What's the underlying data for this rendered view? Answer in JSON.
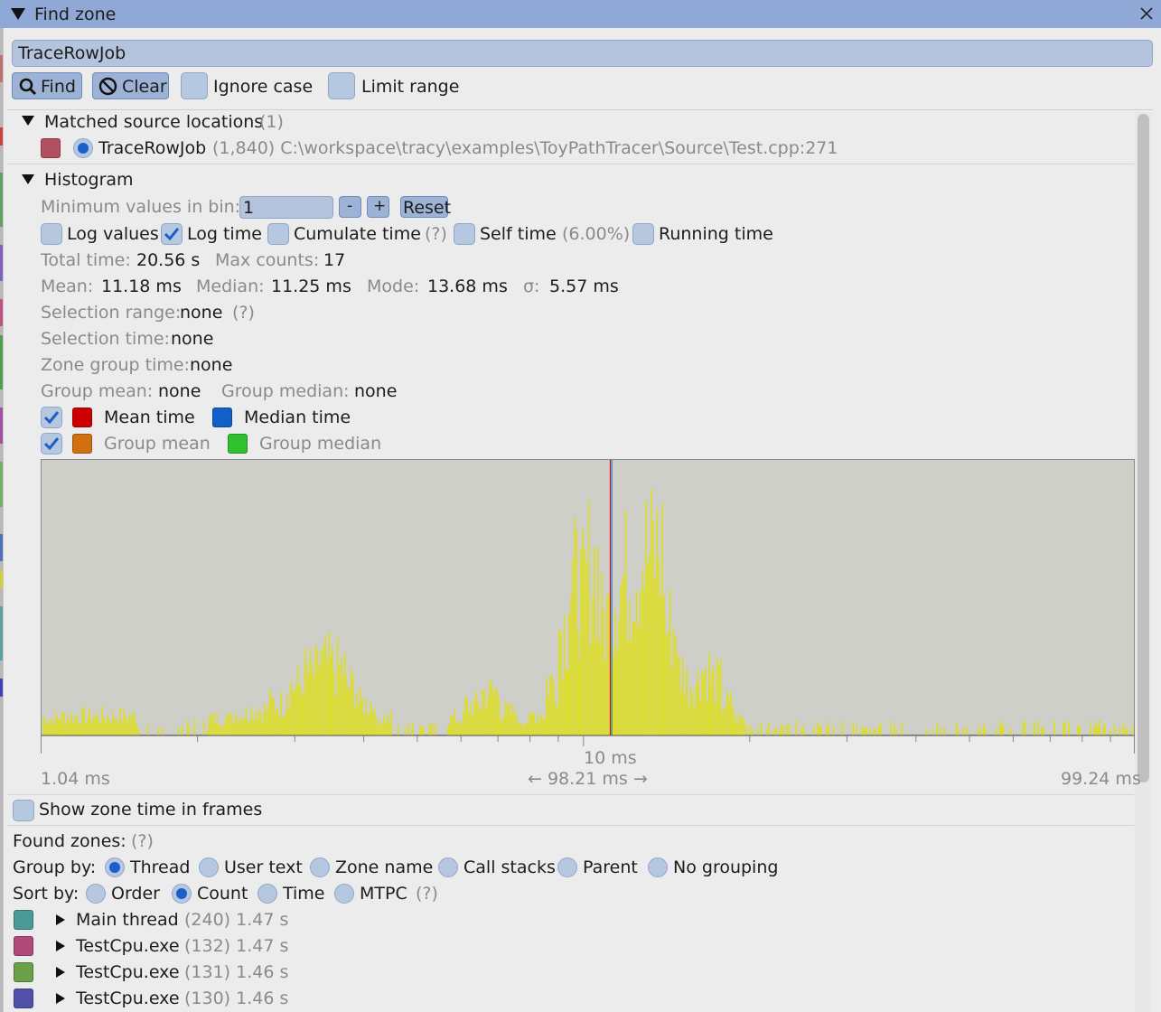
{
  "window": {
    "title": "Find zone",
    "close_icon": "close-icon"
  },
  "search": {
    "value": "TraceRowJob"
  },
  "toolbar": {
    "find_label": "Find",
    "find_icon": "search-icon",
    "clear_label": "Clear",
    "clear_icon": "ban-icon",
    "ignore_case_label": "Ignore case",
    "ignore_case_checked": false,
    "limit_range_label": "Limit range",
    "limit_range_checked": false
  },
  "matched": {
    "header": "Matched source locations",
    "count": "(1)",
    "item": {
      "name": "TraceRowJob",
      "info": "(1,840) C:\\workspace\\tracy\\examples\\ToyPathTracer\\Source\\Test.cpp:271",
      "color": "#b05060",
      "selected": true
    }
  },
  "histogram": {
    "header": "Histogram",
    "min_bin_label": "Minimum values in bin:",
    "min_bin_value": "1",
    "minus_label": "-",
    "plus_label": "+",
    "reset_label": "Reset",
    "options": {
      "log_values": {
        "label": "Log values",
        "checked": false
      },
      "log_time": {
        "label": "Log time",
        "checked": true
      },
      "cumulate_time": {
        "label": "Cumulate time",
        "checked": false,
        "hint": "(?)"
      },
      "self_time": {
        "label": "Self time",
        "checked": false,
        "extra": "(6.00%)"
      },
      "running_time": {
        "label": "Running time",
        "checked": false
      }
    },
    "stats": {
      "total_time_label": "Total time:",
      "total_time": "20.56 s",
      "max_counts_label": "Max counts:",
      "max_counts": "17",
      "mean_label": "Mean:",
      "mean": "11.18 ms",
      "median_label": "Median:",
      "median": "11.25 ms",
      "mode_label": "Mode:",
      "mode": "13.68 ms",
      "sigma_label": "σ:",
      "sigma": "5.57 ms",
      "sel_range_label": "Selection range:",
      "sel_range": "none",
      "sel_range_hint": "(?)",
      "sel_time_label": "Selection time:",
      "sel_time": "none",
      "zone_group_label": "Zone group time:",
      "zone_group": "none",
      "group_mean_label": "Group mean:",
      "group_mean": "none",
      "group_median_label": "Group median:",
      "group_median": "none"
    },
    "markers": {
      "mean_time": {
        "label": "Mean time",
        "color": "#cc0000",
        "checked": true
      },
      "median_time": {
        "label": "Median time",
        "color": "#1060c8"
      },
      "group_mean": {
        "label": "Group mean",
        "color": "#d07010",
        "checked": true
      },
      "group_median": {
        "label": "Group median",
        "color": "#30c030"
      }
    },
    "axis": {
      "left": "1.04 ms",
      "mid": "10 ms",
      "right": "99.24 ms",
      "range": "← 98.21 ms →"
    }
  },
  "chart_data": {
    "type": "bar",
    "xscale": "log",
    "xlim": [
      1.04,
      99.24
    ],
    "xlabel": "",
    "ylabel": "",
    "bar_color": "#dede20",
    "mean_ms": 11.18,
    "median_ms": 11.25,
    "bins": [
      {
        "x": 1.06,
        "y": 1.6
      },
      {
        "x": 1.2,
        "y": 1.8
      },
      {
        "x": 2.0,
        "y": 1.0
      },
      {
        "x": 2.2,
        "y": 1.6
      },
      {
        "x": 2.4,
        "y": 2.0
      },
      {
        "x": 2.6,
        "y": 2.4
      },
      {
        "x": 2.8,
        "y": 3.0
      },
      {
        "x": 3.0,
        "y": 4.6
      },
      {
        "x": 3.2,
        "y": 5.8
      },
      {
        "x": 3.4,
        "y": 6.6
      },
      {
        "x": 3.6,
        "y": 6.2
      },
      {
        "x": 3.8,
        "y": 4.6
      },
      {
        "x": 4.0,
        "y": 3.0
      },
      {
        "x": 4.3,
        "y": 1.6
      },
      {
        "x": 4.7,
        "y": 1.2
      },
      {
        "x": 5.1,
        "y": 1.0
      },
      {
        "x": 5.5,
        "y": 1.0
      },
      {
        "x": 5.9,
        "y": 1.6
      },
      {
        "x": 6.3,
        "y": 2.8
      },
      {
        "x": 6.8,
        "y": 4.0
      },
      {
        "x": 7.3,
        "y": 2.2
      },
      {
        "x": 7.8,
        "y": 1.4
      },
      {
        "x": 8.3,
        "y": 2.0
      },
      {
        "x": 8.8,
        "y": 5.0
      },
      {
        "x": 9.2,
        "y": 10.0
      },
      {
        "x": 9.6,
        "y": 14.0
      },
      {
        "x": 10.0,
        "y": 13.0
      },
      {
        "x": 10.4,
        "y": 15.6
      },
      {
        "x": 10.8,
        "y": 10.5
      },
      {
        "x": 11.2,
        "y": 11.0
      },
      {
        "x": 11.6,
        "y": 14.0
      },
      {
        "x": 12.0,
        "y": 14.6
      },
      {
        "x": 12.5,
        "y": 16.0
      },
      {
        "x": 13.0,
        "y": 16.6
      },
      {
        "x": 13.68,
        "y": 17.0
      },
      {
        "x": 14.3,
        "y": 10.0
      },
      {
        "x": 15.0,
        "y": 6.0
      },
      {
        "x": 15.7,
        "y": 5.0
      },
      {
        "x": 16.5,
        "y": 6.0
      },
      {
        "x": 17.3,
        "y": 5.0
      },
      {
        "x": 18.2,
        "y": 3.0
      },
      {
        "x": 19.1,
        "y": 1.6
      },
      {
        "x": 20.0,
        "y": 1.0
      },
      {
        "x": 22.0,
        "y": 1.0
      },
      {
        "x": 24.0,
        "y": 1.0
      },
      {
        "x": 27.0,
        "y": 1.0
      },
      {
        "x": 30.0,
        "y": 1.0
      },
      {
        "x": 34.0,
        "y": 1.0
      },
      {
        "x": 38.0,
        "y": 1.0
      },
      {
        "x": 43.0,
        "y": 1.0
      },
      {
        "x": 48.0,
        "y": 1.0
      },
      {
        "x": 54.0,
        "y": 1.0
      },
      {
        "x": 61.0,
        "y": 1.0
      },
      {
        "x": 70.0,
        "y": 1.0
      },
      {
        "x": 85.0,
        "y": 1.0
      },
      {
        "x": 98.0,
        "y": 1.0
      }
    ]
  },
  "show_frames": {
    "label": "Show zone time in frames",
    "checked": false
  },
  "found": {
    "label": "Found zones:",
    "hint": "(?)",
    "group_by_label": "Group by:",
    "group_by": [
      {
        "label": "Thread",
        "selected": true
      },
      {
        "label": "User text",
        "selected": false
      },
      {
        "label": "Zone name",
        "selected": false
      },
      {
        "label": "Call stacks",
        "selected": false
      },
      {
        "label": "Parent",
        "selected": false
      },
      {
        "label": "No grouping",
        "selected": false
      }
    ],
    "sort_by_label": "Sort by:",
    "sort_by": [
      {
        "label": "Order",
        "selected": false
      },
      {
        "label": "Count",
        "selected": true
      },
      {
        "label": "Time",
        "selected": false
      },
      {
        "label": "MTPC",
        "selected": false
      }
    ],
    "sort_hint": "(?)",
    "rows": [
      {
        "name": "Main thread",
        "info": "(240) 1.47 s",
        "color": "#4a9a9a"
      },
      {
        "name": "TestCpu.exe",
        "info": "(132) 1.47 s",
        "color": "#b04a78"
      },
      {
        "name": "TestCpu.exe",
        "info": "(131) 1.46 s",
        "color": "#6aa048"
      },
      {
        "name": "TestCpu.exe",
        "info": "(130) 1.46 s",
        "color": "#5050a8"
      }
    ]
  }
}
